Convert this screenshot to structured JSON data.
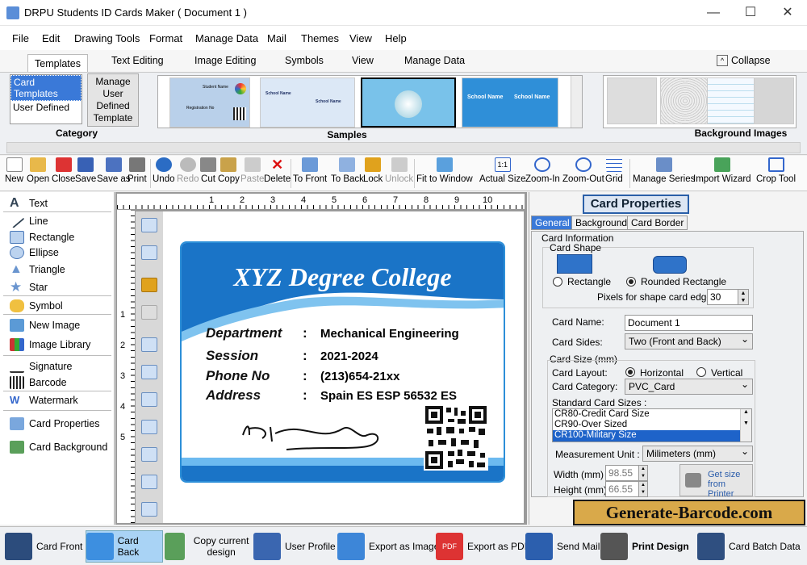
{
  "window": {
    "title": "DRPU Students ID Cards Maker ( Document 1 )"
  },
  "menu": [
    "File",
    "Edit",
    "Drawing Tools",
    "Format",
    "Manage Data",
    "Mail",
    "Themes",
    "View",
    "Help"
  ],
  "ribbon_tabs": [
    "Templates",
    "Text Editing",
    "Image Editing",
    "Symbols",
    "View",
    "Manage Data"
  ],
  "collapse_label": "Collapse",
  "category": {
    "items": [
      "Card Templates",
      "User Defined"
    ],
    "manage_button": "Manage User Defined Template",
    "label": "Category"
  },
  "samples": {
    "label": "Samples",
    "school_name": "School Name",
    "student_name": "Student Name",
    "registration": "Registration No"
  },
  "background_images": {
    "label": "Background Images"
  },
  "toolbar": [
    "New",
    "Open",
    "Close",
    "Save",
    "Save as",
    "Print",
    "Undo",
    "Redo",
    "Cut",
    "Copy",
    "Paste",
    "Delete",
    "To Front",
    "To Back",
    "Lock",
    "Unlock",
    "Fit to Window",
    "Actual Size",
    "Zoom-In",
    "Zoom-Out",
    "Grid",
    "Manage Series",
    "Import Wizard",
    "Crop Tool"
  ],
  "left_tools": [
    "Text",
    "Line",
    "Rectangle",
    "Ellipse",
    "Triangle",
    "Star",
    "Symbol",
    "New Image",
    "Image Library",
    "Signature",
    "Barcode",
    "Watermark",
    "Card Properties",
    "Card Background"
  ],
  "ruler": {
    "h": [
      "1",
      "2",
      "3",
      "4",
      "5",
      "6",
      "7",
      "8",
      "9",
      "10"
    ],
    "v": [
      "1",
      "2",
      "3",
      "4",
      "5"
    ]
  },
  "card": {
    "title": "XYZ Degree College",
    "rows": [
      {
        "label": "Department",
        "value": "Mechanical Engineering"
      },
      {
        "label": "Session",
        "value": "2021-2024"
      },
      {
        "label": "Phone No",
        "value": "(213)654-21xx"
      },
      {
        "label": "Address",
        "value": "Spain ES ESP 56532 ES"
      }
    ],
    "colors": {
      "band": "#1a74c7",
      "border": "#2d8fd8"
    }
  },
  "props": {
    "title": "Card Properties",
    "tabs": [
      "General",
      "Background",
      "Card Border"
    ],
    "card_information": "Card Information",
    "card_shape": "Card Shape",
    "shape_rect": "Rectangle",
    "shape_round": "Rounded Rectangle",
    "pixels_label": "Pixels for shape card edge :",
    "pixels_value": "30",
    "card_name_label": "Card Name:",
    "card_name_value": "Document 1",
    "card_sides_label": "Card Sides:",
    "card_sides_value": "Two (Front and Back)",
    "card_size_label": "Card Size (mm)",
    "layout_label": "Card Layout:",
    "layout_h": "Horizontal",
    "layout_v": "Vertical",
    "category_label": "Card Category:",
    "category_value": "PVC_Card",
    "standard_sizes_label": "Standard Card Sizes :",
    "standard_sizes": [
      "CR80-Credit Card Size",
      "CR90-Over Sized",
      "CR100-Military Size"
    ],
    "measurement_label": "Measurement Unit :",
    "measurement_value": "Milimeters (mm)",
    "width_label": "Width  (mm)",
    "width_value": "98.55",
    "height_label": "Height  (mm)",
    "height_value": "66.55",
    "get_size": "Get size from Printer"
  },
  "banner": "Generate-Barcode.com",
  "bottom": [
    "Card Front",
    "Card Back",
    "Copy current design",
    "User Profile",
    "Export as Image",
    "Export as PDF",
    "Send Mail",
    "Print Design",
    "Card Batch Data"
  ]
}
